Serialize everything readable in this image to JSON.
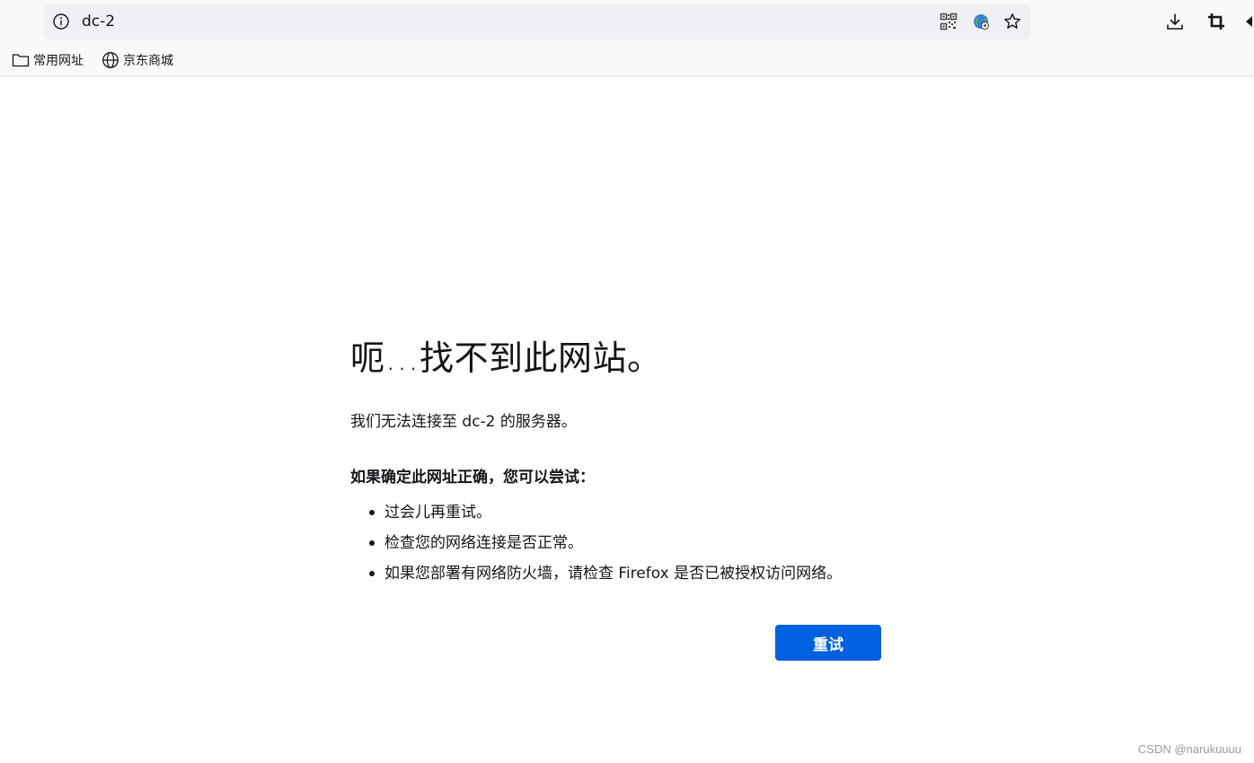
{
  "browser": {
    "url": "dc-2",
    "bookmarks": [
      {
        "label": "常用网址",
        "icon": "folder-icon"
      },
      {
        "label": "京东商城",
        "icon": "globe-icon"
      }
    ],
    "url_actions": [
      "qr-code-icon",
      "translate-globe-icon",
      "bookmark-star-icon"
    ],
    "toolbar_buttons": [
      "download-icon",
      "crop-screenshot-icon",
      "overflow-arrow-icon"
    ]
  },
  "error_page": {
    "title": "呃…找不到此网站。",
    "description": "我们无法连接至 dc-2 的服务器。",
    "suggest_title": "如果确定此网址正确，您可以尝试：",
    "suggestions": [
      "过会儿再重试。",
      "检查您的网络连接是否正常。",
      "如果您部署有网络防火墙，请检查 Firefox 是否已被授权访问网络。"
    ],
    "retry_label": "重试"
  },
  "watermark": "CSDN @narukuuuu",
  "colors": {
    "accent": "#0061e0",
    "toolbar_bg": "#f9f9fb",
    "urlbar_bg": "#f0f0f4",
    "text": "#15141a"
  }
}
